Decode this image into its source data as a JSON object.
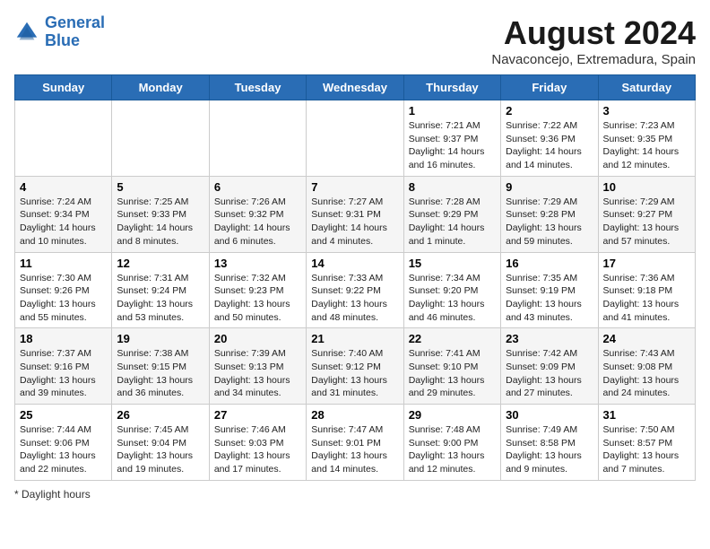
{
  "logo": {
    "line1": "General",
    "line2": "Blue"
  },
  "title": "August 2024",
  "subtitle": "Navaconcejo, Extremadura, Spain",
  "days_of_week": [
    "Sunday",
    "Monday",
    "Tuesday",
    "Wednesday",
    "Thursday",
    "Friday",
    "Saturday"
  ],
  "weeks": [
    [
      {
        "num": "",
        "info": ""
      },
      {
        "num": "",
        "info": ""
      },
      {
        "num": "",
        "info": ""
      },
      {
        "num": "",
        "info": ""
      },
      {
        "num": "1",
        "info": "Sunrise: 7:21 AM\nSunset: 9:37 PM\nDaylight: 14 hours and 16 minutes."
      },
      {
        "num": "2",
        "info": "Sunrise: 7:22 AM\nSunset: 9:36 PM\nDaylight: 14 hours and 14 minutes."
      },
      {
        "num": "3",
        "info": "Sunrise: 7:23 AM\nSunset: 9:35 PM\nDaylight: 14 hours and 12 minutes."
      }
    ],
    [
      {
        "num": "4",
        "info": "Sunrise: 7:24 AM\nSunset: 9:34 PM\nDaylight: 14 hours and 10 minutes."
      },
      {
        "num": "5",
        "info": "Sunrise: 7:25 AM\nSunset: 9:33 PM\nDaylight: 14 hours and 8 minutes."
      },
      {
        "num": "6",
        "info": "Sunrise: 7:26 AM\nSunset: 9:32 PM\nDaylight: 14 hours and 6 minutes."
      },
      {
        "num": "7",
        "info": "Sunrise: 7:27 AM\nSunset: 9:31 PM\nDaylight: 14 hours and 4 minutes."
      },
      {
        "num": "8",
        "info": "Sunrise: 7:28 AM\nSunset: 9:29 PM\nDaylight: 14 hours and 1 minute."
      },
      {
        "num": "9",
        "info": "Sunrise: 7:29 AM\nSunset: 9:28 PM\nDaylight: 13 hours and 59 minutes."
      },
      {
        "num": "10",
        "info": "Sunrise: 7:29 AM\nSunset: 9:27 PM\nDaylight: 13 hours and 57 minutes."
      }
    ],
    [
      {
        "num": "11",
        "info": "Sunrise: 7:30 AM\nSunset: 9:26 PM\nDaylight: 13 hours and 55 minutes."
      },
      {
        "num": "12",
        "info": "Sunrise: 7:31 AM\nSunset: 9:24 PM\nDaylight: 13 hours and 53 minutes."
      },
      {
        "num": "13",
        "info": "Sunrise: 7:32 AM\nSunset: 9:23 PM\nDaylight: 13 hours and 50 minutes."
      },
      {
        "num": "14",
        "info": "Sunrise: 7:33 AM\nSunset: 9:22 PM\nDaylight: 13 hours and 48 minutes."
      },
      {
        "num": "15",
        "info": "Sunrise: 7:34 AM\nSunset: 9:20 PM\nDaylight: 13 hours and 46 minutes."
      },
      {
        "num": "16",
        "info": "Sunrise: 7:35 AM\nSunset: 9:19 PM\nDaylight: 13 hours and 43 minutes."
      },
      {
        "num": "17",
        "info": "Sunrise: 7:36 AM\nSunset: 9:18 PM\nDaylight: 13 hours and 41 minutes."
      }
    ],
    [
      {
        "num": "18",
        "info": "Sunrise: 7:37 AM\nSunset: 9:16 PM\nDaylight: 13 hours and 39 minutes."
      },
      {
        "num": "19",
        "info": "Sunrise: 7:38 AM\nSunset: 9:15 PM\nDaylight: 13 hours and 36 minutes."
      },
      {
        "num": "20",
        "info": "Sunrise: 7:39 AM\nSunset: 9:13 PM\nDaylight: 13 hours and 34 minutes."
      },
      {
        "num": "21",
        "info": "Sunrise: 7:40 AM\nSunset: 9:12 PM\nDaylight: 13 hours and 31 minutes."
      },
      {
        "num": "22",
        "info": "Sunrise: 7:41 AM\nSunset: 9:10 PM\nDaylight: 13 hours and 29 minutes."
      },
      {
        "num": "23",
        "info": "Sunrise: 7:42 AM\nSunset: 9:09 PM\nDaylight: 13 hours and 27 minutes."
      },
      {
        "num": "24",
        "info": "Sunrise: 7:43 AM\nSunset: 9:08 PM\nDaylight: 13 hours and 24 minutes."
      }
    ],
    [
      {
        "num": "25",
        "info": "Sunrise: 7:44 AM\nSunset: 9:06 PM\nDaylight: 13 hours and 22 minutes."
      },
      {
        "num": "26",
        "info": "Sunrise: 7:45 AM\nSunset: 9:04 PM\nDaylight: 13 hours and 19 minutes."
      },
      {
        "num": "27",
        "info": "Sunrise: 7:46 AM\nSunset: 9:03 PM\nDaylight: 13 hours and 17 minutes."
      },
      {
        "num": "28",
        "info": "Sunrise: 7:47 AM\nSunset: 9:01 PM\nDaylight: 13 hours and 14 minutes."
      },
      {
        "num": "29",
        "info": "Sunrise: 7:48 AM\nSunset: 9:00 PM\nDaylight: 13 hours and 12 minutes."
      },
      {
        "num": "30",
        "info": "Sunrise: 7:49 AM\nSunset: 8:58 PM\nDaylight: 13 hours and 9 minutes."
      },
      {
        "num": "31",
        "info": "Sunrise: 7:50 AM\nSunset: 8:57 PM\nDaylight: 13 hours and 7 minutes."
      }
    ]
  ],
  "footer": "Daylight hours"
}
